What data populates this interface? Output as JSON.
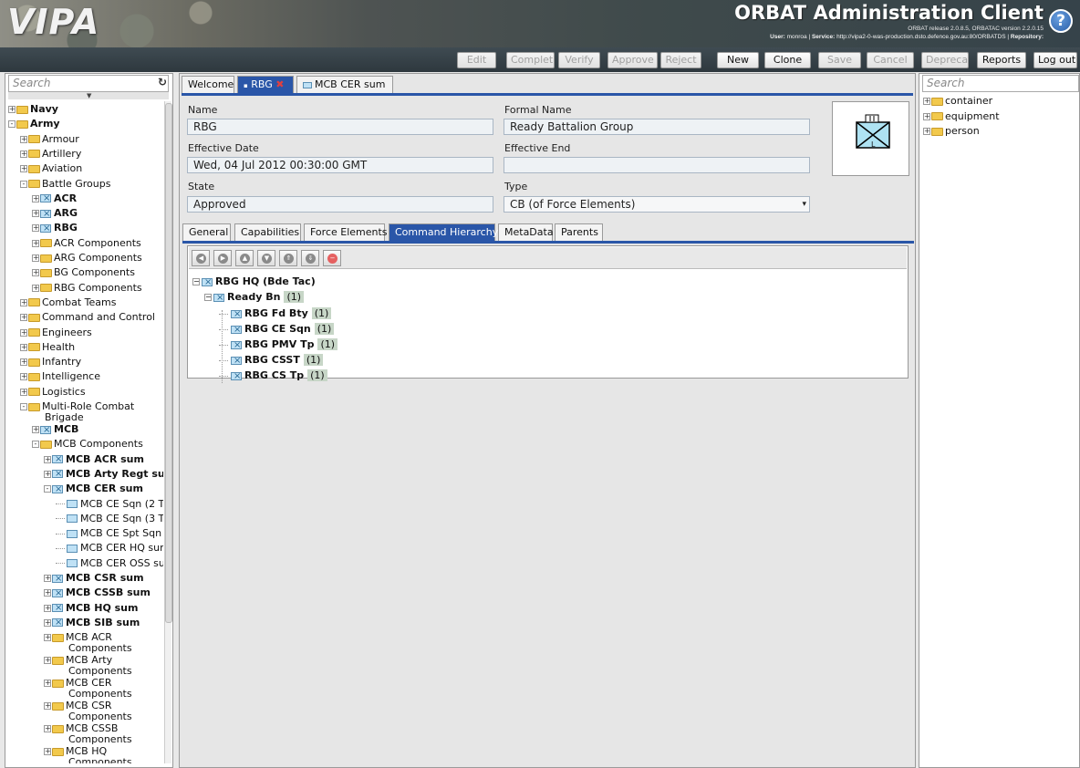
{
  "header": {
    "logo": "VIPA",
    "title": "ORBAT Administration Client",
    "release_line": "ORBAT release 2.0.8.5, ORBATAC version 2.2.0.15",
    "user_label": "User:",
    "user": "monroa",
    "service_label": "Service:",
    "service": "http://vipa2-0-was-production.dsto.defence.gov.au:80/ORBATDS",
    "repository_label": "Repository:"
  },
  "toolbar": {
    "edit": "Edit",
    "complete": "Complet",
    "verify": "Verify",
    "approve": "Approve",
    "reject": "Reject",
    "new": "New",
    "clone": "Clone",
    "save": "Save",
    "cancel": "Cancel",
    "deprecate": "Deprecal",
    "reports": "Reports",
    "logout": "Log out"
  },
  "left": {
    "search_placeholder": "Search",
    "tree": [
      {
        "label": "Navy",
        "bold": true,
        "icon": "folder",
        "depth": 0,
        "exp": "+"
      },
      {
        "label": "Army",
        "bold": true,
        "icon": "folder",
        "depth": 0,
        "exp": "-"
      },
      {
        "label": "Armour",
        "bold": false,
        "icon": "folder",
        "depth": 1,
        "exp": "+"
      },
      {
        "label": "Artillery",
        "bold": false,
        "icon": "folder",
        "depth": 1,
        "exp": "+"
      },
      {
        "label": "Aviation",
        "bold": false,
        "icon": "folder",
        "depth": 1,
        "exp": "+"
      },
      {
        "label": "Battle Groups",
        "bold": false,
        "icon": "folder",
        "depth": 1,
        "exp": "-"
      },
      {
        "label": "ACR",
        "bold": true,
        "icon": "unit",
        "depth": 2,
        "exp": "+"
      },
      {
        "label": "ARG",
        "bold": true,
        "icon": "unit",
        "depth": 2,
        "exp": "+"
      },
      {
        "label": "RBG",
        "bold": true,
        "icon": "unit",
        "depth": 2,
        "exp": "+"
      },
      {
        "label": "ACR Components",
        "bold": false,
        "icon": "folder",
        "depth": 2,
        "exp": "+"
      },
      {
        "label": "ARG Components",
        "bold": false,
        "icon": "folder",
        "depth": 2,
        "exp": "+"
      },
      {
        "label": "BG Components",
        "bold": false,
        "icon": "folder",
        "depth": 2,
        "exp": "+"
      },
      {
        "label": "RBG Components",
        "bold": false,
        "icon": "folder",
        "depth": 2,
        "exp": "+"
      },
      {
        "label": "Combat Teams",
        "bold": false,
        "icon": "folder",
        "depth": 1,
        "exp": "+"
      },
      {
        "label": "Command and Control",
        "bold": false,
        "icon": "folder",
        "depth": 1,
        "exp": "+"
      },
      {
        "label": "Engineers",
        "bold": false,
        "icon": "folder",
        "depth": 1,
        "exp": "+"
      },
      {
        "label": "Health",
        "bold": false,
        "icon": "folder",
        "depth": 1,
        "exp": "+"
      },
      {
        "label": "Infantry",
        "bold": false,
        "icon": "folder",
        "depth": 1,
        "exp": "+"
      },
      {
        "label": "Intelligence",
        "bold": false,
        "icon": "folder",
        "depth": 1,
        "exp": "+"
      },
      {
        "label": "Logistics",
        "bold": false,
        "icon": "folder",
        "depth": 1,
        "exp": "+"
      },
      {
        "label": "Multi-Role Combat",
        "label2": "Brigade",
        "bold": false,
        "icon": "folder",
        "depth": 1,
        "exp": "-"
      },
      {
        "label": "MCB",
        "bold": true,
        "icon": "unit",
        "depth": 2,
        "exp": "+"
      },
      {
        "label": "MCB Components",
        "bold": false,
        "icon": "folder",
        "depth": 2,
        "exp": "-"
      },
      {
        "label": "MCB ACR sum",
        "bold": true,
        "icon": "unit",
        "depth": 3,
        "exp": "+"
      },
      {
        "label": "MCB Arty Regt sum",
        "bold": true,
        "icon": "unit",
        "depth": 3,
        "exp": "+"
      },
      {
        "label": "MCB CER sum",
        "bold": true,
        "icon": "unit",
        "depth": 3,
        "exp": "-"
      },
      {
        "label": "MCB CE Sqn (2 T",
        "bold": false,
        "icon": "unit",
        "depth": 4,
        "exp": ""
      },
      {
        "label": "MCB CE Sqn (3 T",
        "bold": false,
        "icon": "unit",
        "depth": 4,
        "exp": ""
      },
      {
        "label": "MCB CE Spt Sqn",
        "bold": false,
        "icon": "unit",
        "depth": 4,
        "exp": ""
      },
      {
        "label": "MCB CER HQ sun",
        "bold": false,
        "icon": "unit",
        "depth": 4,
        "exp": ""
      },
      {
        "label": "MCB CER OSS su",
        "bold": false,
        "icon": "unit",
        "depth": 4,
        "exp": ""
      },
      {
        "label": "MCB CSR sum",
        "bold": true,
        "icon": "unit",
        "depth": 3,
        "exp": "+"
      },
      {
        "label": "MCB CSSB sum",
        "bold": true,
        "icon": "unit",
        "depth": 3,
        "exp": "+"
      },
      {
        "label": "MCB HQ sum",
        "bold": true,
        "icon": "unit",
        "depth": 3,
        "exp": "+"
      },
      {
        "label": "MCB SIB sum",
        "bold": true,
        "icon": "unit",
        "depth": 3,
        "exp": "+"
      },
      {
        "label": "MCB ACR",
        "label2": "Components",
        "bold": false,
        "icon": "folder",
        "depth": 3,
        "exp": "+"
      },
      {
        "label": "MCB Arty",
        "label2": "Components",
        "bold": false,
        "icon": "folder",
        "depth": 3,
        "exp": "+"
      },
      {
        "label": "MCB CER",
        "label2": "Components",
        "bold": false,
        "icon": "folder",
        "depth": 3,
        "exp": "+"
      },
      {
        "label": "MCB CSR",
        "label2": "Components",
        "bold": false,
        "icon": "folder",
        "depth": 3,
        "exp": "+"
      },
      {
        "label": "MCB CSSB",
        "label2": "Components",
        "bold": false,
        "icon": "folder",
        "depth": 3,
        "exp": "+"
      },
      {
        "label": "MCB HQ",
        "label2": "Components",
        "bold": false,
        "icon": "folder",
        "depth": 3,
        "exp": "+"
      }
    ]
  },
  "main_tabs": [
    {
      "label": "Welcome",
      "active": false
    },
    {
      "label": "RBG",
      "active": true
    },
    {
      "label": "MCB CER sum",
      "active": false
    }
  ],
  "form": {
    "name_label": "Name",
    "name_value": "RBG",
    "formal_label": "Formal Name",
    "formal_value": "Ready Battalion Group",
    "eff_date_label": "Effective Date",
    "eff_date_value": "Wed, 04 Jul 2012 00:30:00 GMT",
    "eff_end_label": "Effective End",
    "eff_end_value": "",
    "state_label": "State",
    "state_value": "Approved",
    "type_label": "Type",
    "type_value": "CB (of Force Elements)",
    "symbol_letter": "L"
  },
  "sub_tabs": [
    {
      "label": "General",
      "active": false
    },
    {
      "label": "Capabilities",
      "active": false
    },
    {
      "label": "Force Elements",
      "active": false
    },
    {
      "label": "Command Hierarchy",
      "active": true
    },
    {
      "label": "MetaData",
      "active": false
    },
    {
      "label": "Parents",
      "active": false
    }
  ],
  "hierarchy": [
    {
      "name": "RBG HQ (Bde Tac)",
      "count": "",
      "depth": 0
    },
    {
      "name": "Ready Bn",
      "count": "(1)",
      "depth": 1
    },
    {
      "name": "RBG Fd Bty",
      "count": "(1)",
      "depth": 2
    },
    {
      "name": "RBG CE Sqn",
      "count": "(1)",
      "depth": 2
    },
    {
      "name": "RBG PMV Tp",
      "count": "(1)",
      "depth": 2
    },
    {
      "name": "RBG CSST",
      "count": "(1)",
      "depth": 2
    },
    {
      "name": "RBG CS Tp",
      "count": "(1)",
      "depth": 2
    }
  ],
  "right": {
    "search_placeholder": "Search",
    "tree": [
      "container",
      "equipment",
      "person"
    ]
  },
  "colors": {
    "accent": "#2a56a8",
    "count_bg": "#c7d6c7"
  }
}
